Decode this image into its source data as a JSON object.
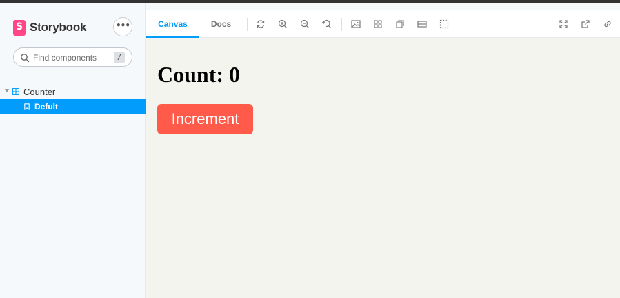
{
  "app": {
    "brand": "Storybook",
    "menu_label": "•••"
  },
  "search": {
    "placeholder": "Find components",
    "shortcut": "/"
  },
  "sidebar": {
    "component": {
      "label": "Counter",
      "icon": "component-icon"
    },
    "story": {
      "label": "Defult",
      "icon": "bookmark-icon",
      "selected": true
    }
  },
  "toolbar": {
    "tabs": [
      {
        "label": "Canvas",
        "active": true
      },
      {
        "label": "Docs",
        "active": false
      }
    ],
    "tools": [
      "reload-icon",
      "zoom-in-icon",
      "zoom-out-icon",
      "zoom-reset-icon",
      "background-icon",
      "grid-icon",
      "viewport-icon",
      "measure-icon",
      "outline-icon"
    ],
    "right_tools": [
      "fullscreen-icon",
      "open-new-tab-icon",
      "copy-link-icon"
    ]
  },
  "story": {
    "count_text": "Count: 0",
    "button_label": "Increment"
  },
  "colors": {
    "accent": "#029cfd",
    "brand": "#ff4785",
    "button": "#ff5a4a",
    "canvas_bg": "#f4f4ef"
  }
}
